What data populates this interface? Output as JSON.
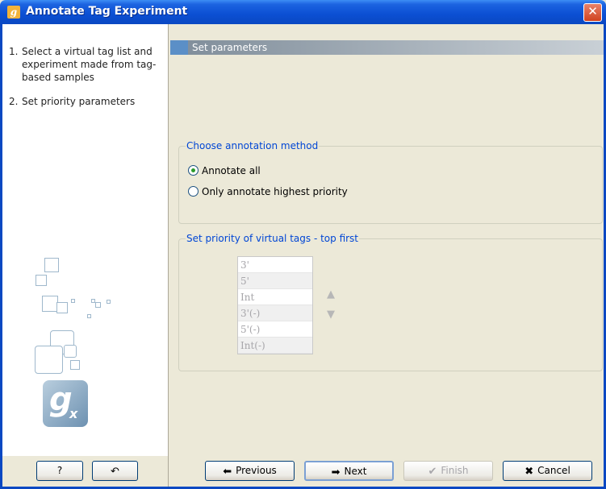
{
  "window": {
    "title": "Annotate Tag Experiment",
    "app_icon": "g"
  },
  "steps": [
    {
      "num": "1.",
      "label": "Select a virtual tag list and experiment made from tag-based samples"
    },
    {
      "num": "2.",
      "label": "Set priority parameters"
    }
  ],
  "logo": {
    "g": "g",
    "x": "x"
  },
  "section": {
    "title": "Set parameters"
  },
  "annotation_method": {
    "legend": "Choose annotation method",
    "options": [
      {
        "label": "Annotate all",
        "checked": true
      },
      {
        "label": "Only annotate highest priority",
        "checked": false
      }
    ]
  },
  "priority": {
    "legend": "Set priority of virtual tags - top first",
    "tags": [
      "3'",
      "5'",
      "Int",
      "3'(-)",
      "5'(-)",
      "Int(-)"
    ],
    "up_icon": "arrow-up-icon",
    "down_icon": "arrow-down-icon"
  },
  "buttons": {
    "help": "?",
    "reset_icon": "reset-icon",
    "previous": "Previous",
    "next": "Next",
    "finish": "Finish",
    "cancel": "Cancel"
  },
  "colors": {
    "titlebar": "#0a48c2",
    "legend_text": "#0046d5",
    "section_marker": "#5b8fc7",
    "radio_dot": "#2b9b2b"
  }
}
